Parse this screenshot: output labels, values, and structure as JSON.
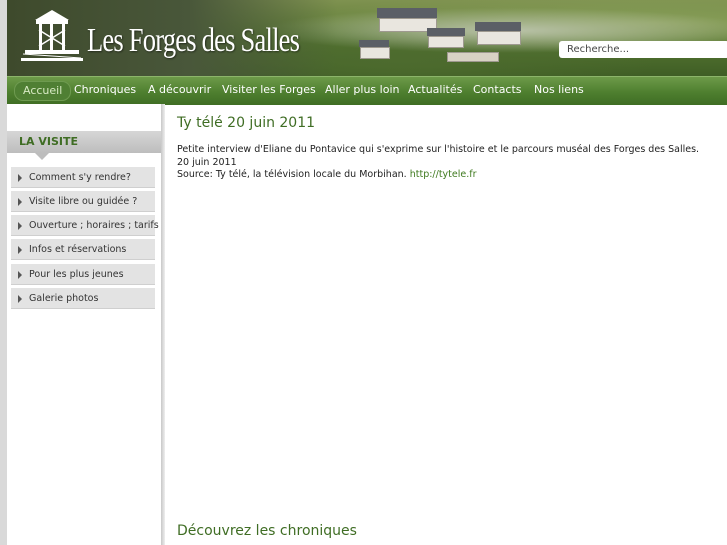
{
  "header": {
    "site_name": "Les Forges des Salles",
    "search_placeholder": "Recherche..."
  },
  "nav": {
    "items": [
      {
        "label": "Accueil",
        "active": true
      },
      {
        "label": "Chroniques"
      },
      {
        "label": "A découvrir"
      },
      {
        "label": "Visiter les Forges"
      },
      {
        "label": "Aller plus loin"
      },
      {
        "label": "Actualités"
      },
      {
        "label": "Contacts"
      },
      {
        "label": "Nos liens"
      }
    ]
  },
  "sidebar": {
    "heading": "LA VISITE",
    "items": [
      {
        "label": "Comment s'y rendre?"
      },
      {
        "label": "Visite libre ou guidée ?"
      },
      {
        "label": "Ouverture ; horaires ; tarifs"
      },
      {
        "label": "Infos et réservations"
      },
      {
        "label": "Pour les plus jeunes"
      },
      {
        "label": "Galerie photos"
      }
    ]
  },
  "article": {
    "title": "Ty télé 20 juin 2011",
    "line1": "Petite interview d'Eliane du Pontavice qui s'exprime sur l'histoire et le parcours muséal des Forges des Salles.",
    "line2": "20 juin 2011",
    "source_prefix": "Source: Ty télé, la télévision locale du Morbihan.",
    "source_link": "http://tytele.fr"
  },
  "section": {
    "title": "Découvrez les chroniques"
  },
  "colors": {
    "brand_green": "#3f6d24",
    "nav_green": "#4e7f2f",
    "link_green": "#3f7a1f"
  },
  "icons": {
    "logo": "forge-tower-icon",
    "sidebar_bullet": "triangle-right-icon"
  }
}
